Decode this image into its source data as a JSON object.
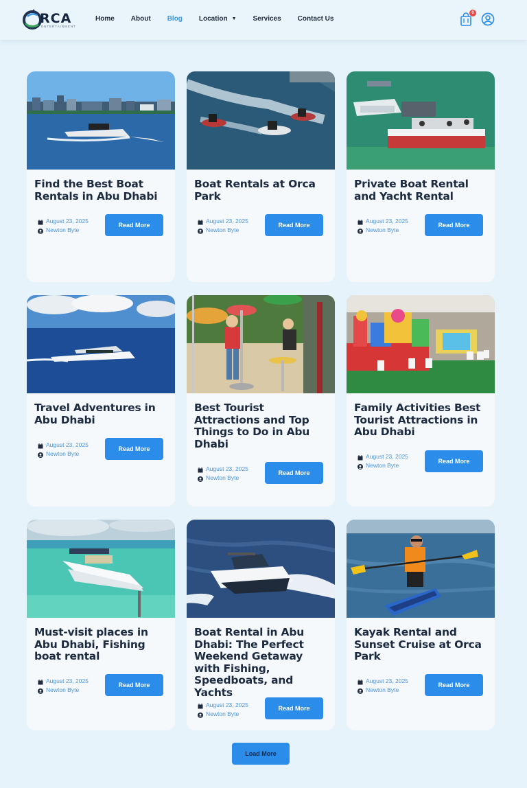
{
  "header": {
    "logo_text": "RCA",
    "logo_sub": "ENTERTAINMENT",
    "nav": [
      {
        "label": "Home",
        "active": false
      },
      {
        "label": "About",
        "active": false
      },
      {
        "label": "Blog",
        "active": true
      },
      {
        "label": "Location",
        "active": false,
        "dropdown": true
      },
      {
        "label": "Services",
        "active": false
      },
      {
        "label": "Contact Us",
        "active": false
      }
    ],
    "cart_count": "0"
  },
  "colors": {
    "accent": "#2b8cea",
    "active_nav": "#3b98e6",
    "background": "#e6f3fb"
  },
  "posts": [
    {
      "title": "Find the Best Boat Rentals in Abu Dhabi",
      "date": "August 23, 2025",
      "author": "Newton Byte",
      "button": "Read More"
    },
    {
      "title": "Boat Rentals at Orca Park",
      "date": "August 23, 2025",
      "author": "Newton Byte",
      "button": "Read More"
    },
    {
      "title": "Private Boat Rental and Yacht Rental",
      "date": "August 23, 2025",
      "author": "Newton Byte",
      "button": "Read More"
    },
    {
      "title": "Travel Adventures in Abu Dhabi",
      "date": "August 23, 2025",
      "author": "Newton Byte",
      "button": "Read More"
    },
    {
      "title": "Best Tourist Attractions and Top Things to Do in Abu Dhabi",
      "date": "August 23, 2025",
      "author": "Newton Byte",
      "button": "Read More"
    },
    {
      "title": "Family Activities Best Tourist Attractions in Abu Dhabi",
      "date": "August 23, 2025",
      "author": "Newton Byte",
      "button": "Read More"
    },
    {
      "title": "Must-visit places in Abu Dhabi, Fishing boat rental",
      "date": "August 23, 2025",
      "author": "Newton Byte",
      "button": "Read More"
    },
    {
      "title": "Boat Rental in Abu Dhabi: The Perfect Weekend Getaway with Fishing, Speedboats, and Yachts",
      "date": "August 23, 2025",
      "author": "Newton Byte",
      "button": "Read More"
    },
    {
      "title": "Kayak Rental and Sunset Cruise at Orca Park",
      "date": "August 23, 2025",
      "author": "Newton Byte",
      "button": "Read More"
    }
  ],
  "load_more": "Load More"
}
